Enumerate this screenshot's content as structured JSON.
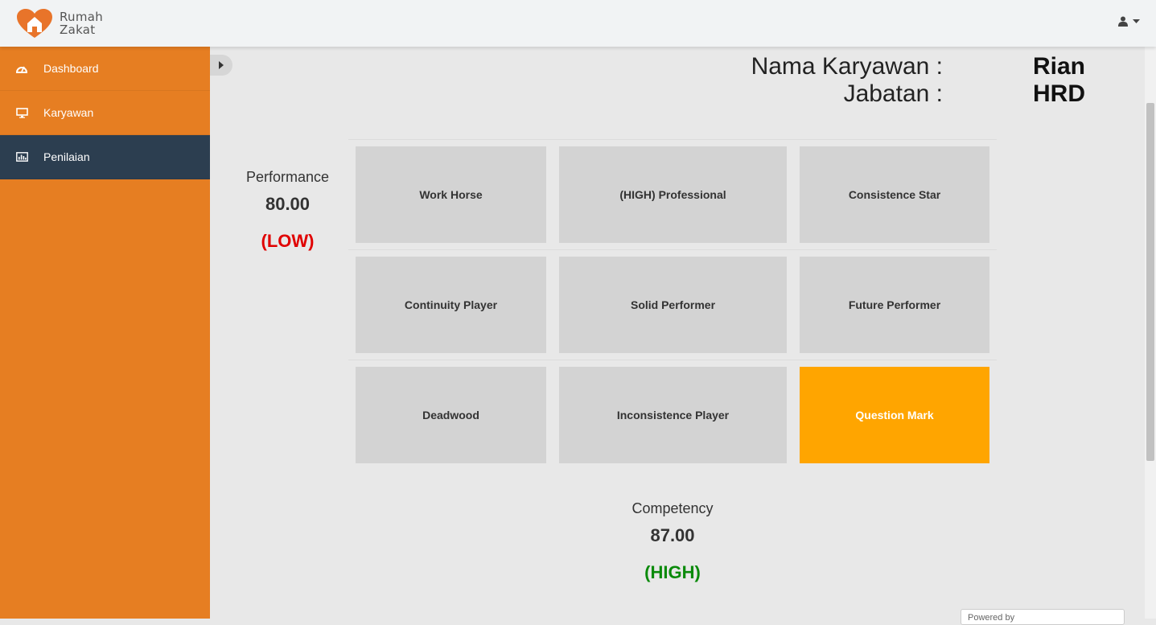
{
  "header": {
    "logo_line1": "Rumah",
    "logo_line2": "Zakat",
    "user_icon": "user-icon",
    "dropdown_icon": "caret-down-icon"
  },
  "sidebar": {
    "items": [
      {
        "label": "Dashboard",
        "icon": "dashboard-icon"
      },
      {
        "label": "Karyawan",
        "icon": "monitor-icon"
      },
      {
        "label": "Penilaian",
        "icon": "bar-chart-icon"
      }
    ],
    "active_index": 2
  },
  "employee": {
    "name_label": "Nama Karyawan :",
    "name_value": "Rian",
    "position_label": "Jabatan :",
    "position_value": "HRD"
  },
  "performance": {
    "label": "Performance",
    "value": "80.00",
    "level": "(LOW)"
  },
  "competency": {
    "label": "Competency",
    "value": "87.00",
    "level": "(HIGH)"
  },
  "grid": {
    "row1": [
      "Work Horse",
      "(HIGH) Professional",
      "Consistence Star"
    ],
    "row2": [
      "Continuity Player",
      "Solid Performer",
      "Future Performer"
    ],
    "row3": [
      "Deadwood",
      "Inconsistence Player",
      "Question Mark"
    ],
    "highlighted": "Question Mark"
  },
  "colors": {
    "sidebar": "#e67e22",
    "active_nav": "#2c3e50",
    "highlight": "#ffa500",
    "low": "#e00000",
    "high": "#0a8a0a"
  },
  "footer": {
    "badge_text": "Powered by"
  }
}
